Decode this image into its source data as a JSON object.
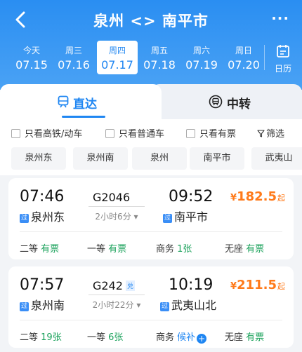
{
  "header": {
    "title": "泉州 <> 南平市",
    "more": "···"
  },
  "dates": [
    {
      "weekday": "今天",
      "date": "07.15",
      "selected": false
    },
    {
      "weekday": "周三",
      "date": "07.16",
      "selected": false
    },
    {
      "weekday": "周四",
      "date": "07.17",
      "selected": true
    },
    {
      "weekday": "周五",
      "date": "07.18",
      "selected": false
    },
    {
      "weekday": "周六",
      "date": "07.19",
      "selected": false
    },
    {
      "weekday": "周日",
      "date": "07.20",
      "selected": false
    }
  ],
  "calendar_label": "日历",
  "tabs": {
    "direct": "直达",
    "transfer": "中转"
  },
  "filters": {
    "high_speed": "只看高铁/动车",
    "normal": "只看普通车",
    "available": "只看有票",
    "filter": "筛选"
  },
  "stations": [
    "泉州东",
    "泉州南",
    "泉州",
    "南平市",
    "武夷山"
  ],
  "trains": [
    {
      "dep_time": "07:46",
      "arr_time": "09:52",
      "train_no": "G2046",
      "badge": "",
      "duration": "2小时6分",
      "dep_station": "泉州东",
      "arr_station": "南平市",
      "pass_mark": "过",
      "price_symbol": "¥",
      "price": "182.5",
      "price_suffix": "起",
      "seats": [
        {
          "name": "二等",
          "status": "有票"
        },
        {
          "name": "一等",
          "status": "有票"
        },
        {
          "name": "商务",
          "status": "1张"
        },
        {
          "name": "无座",
          "status": "有票"
        }
      ]
    },
    {
      "dep_time": "07:57",
      "arr_time": "10:19",
      "train_no": "G242",
      "badge": "兑",
      "duration": "2小时22分",
      "dep_station": "泉州南",
      "arr_station": "武夷山北",
      "pass_mark": "过",
      "price_symbol": "¥",
      "price": "211.5",
      "price_suffix": "起",
      "seats": [
        {
          "name": "二等",
          "status": "19张"
        },
        {
          "name": "一等",
          "status": "6张"
        },
        {
          "name": "商务",
          "status": "候补"
        },
        {
          "name": "无座",
          "status": "有票"
        }
      ]
    }
  ],
  "colors": {
    "primary": "#1f86f2",
    "price": "#ff7a1a",
    "available": "#19a15a"
  }
}
